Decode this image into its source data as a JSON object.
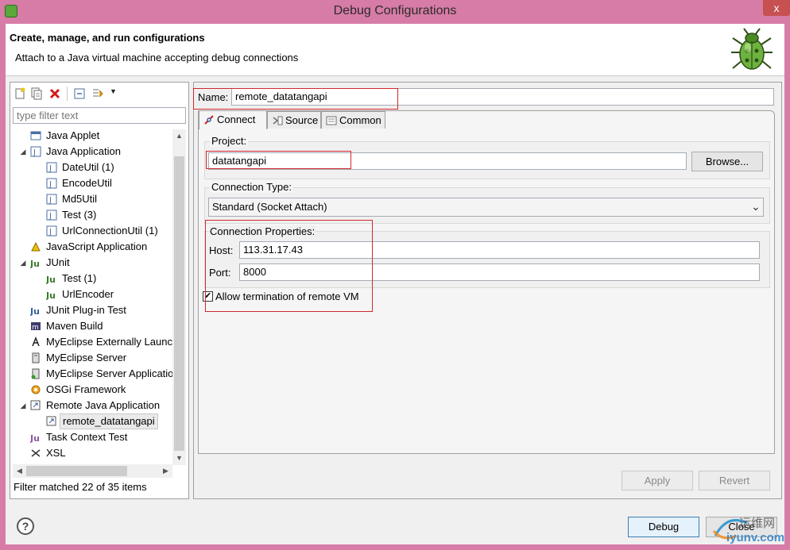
{
  "window": {
    "title": "Debug Configurations",
    "close_glyph": "x"
  },
  "header": {
    "title": "Create, manage, and run configurations",
    "subtitle": "Attach to a Java virtual machine accepting debug connections"
  },
  "toolbar": {
    "icons": [
      "new-configuration-icon",
      "duplicate-icon",
      "delete-icon",
      "collapse-all-icon",
      "filter-icon",
      "dropdown-arrow-icon"
    ],
    "dropdown_glyph": "▼"
  },
  "filter": {
    "placeholder": "type filter text",
    "status": "Filter matched 22 of 35 items"
  },
  "tree": {
    "items": [
      {
        "label": "Java Applet",
        "level": 1,
        "icon": "applet-icon",
        "expander": ""
      },
      {
        "label": "Java Application",
        "level": 1,
        "icon": "java-app-icon",
        "expander": "◢"
      },
      {
        "label": "DateUtil (1)",
        "level": 2,
        "icon": "java-class-icon",
        "expander": ""
      },
      {
        "label": "EncodeUtil",
        "level": 2,
        "icon": "java-class-icon",
        "expander": ""
      },
      {
        "label": "Md5Util",
        "level": 2,
        "icon": "java-class-icon",
        "expander": ""
      },
      {
        "label": "Test (3)",
        "level": 2,
        "icon": "java-class-icon",
        "expander": ""
      },
      {
        "label": "UrlConnectionUtil (1)",
        "level": 2,
        "icon": "java-class-icon",
        "expander": ""
      },
      {
        "label": "JavaScript Application",
        "level": 1,
        "icon": "javascript-icon",
        "expander": ""
      },
      {
        "label": "JUnit",
        "level": 1,
        "icon": "junit-icon",
        "expander": "◢"
      },
      {
        "label": "Test (1)",
        "level": 2,
        "icon": "junit-icon",
        "expander": ""
      },
      {
        "label": "UrlEncoder",
        "level": 2,
        "icon": "junit-icon",
        "expander": ""
      },
      {
        "label": "JUnit Plug-in Test",
        "level": 1,
        "icon": "junit-plugin-icon",
        "expander": ""
      },
      {
        "label": "Maven Build",
        "level": 1,
        "icon": "maven-icon",
        "expander": ""
      },
      {
        "label": "MyEclipse Externally Launch",
        "level": 1,
        "icon": "external-launch-icon",
        "expander": ""
      },
      {
        "label": "MyEclipse Server",
        "level": 1,
        "icon": "server-icon",
        "expander": ""
      },
      {
        "label": "MyEclipse Server Applicatio",
        "level": 1,
        "icon": "server-app-icon",
        "expander": ""
      },
      {
        "label": "OSGi Framework",
        "level": 1,
        "icon": "osgi-icon",
        "expander": ""
      },
      {
        "label": "Remote Java Application",
        "level": 1,
        "icon": "remote-java-icon",
        "expander": "◢"
      },
      {
        "label": "remote_datatangapi",
        "level": 2,
        "icon": "remote-config-icon",
        "expander": "",
        "selected": true
      },
      {
        "label": "Task Context Test",
        "level": 1,
        "icon": "task-context-icon",
        "expander": ""
      },
      {
        "label": "XSL",
        "level": 1,
        "icon": "xsl-icon",
        "expander": ""
      }
    ],
    "scroll_glyphs": {
      "up": "▲",
      "down": "▼",
      "left": "◀",
      "right": "▶"
    }
  },
  "config": {
    "name_label": "Name:",
    "name_value": "remote_datatangapi",
    "tabs": [
      {
        "label": "Connect",
        "icon": "connect-icon",
        "active": true
      },
      {
        "label": "Source",
        "icon": "source-icon",
        "active": false
      },
      {
        "label": "Common",
        "icon": "common-icon",
        "active": false
      }
    ],
    "project_label": "Project:",
    "project_value": "datatangapi",
    "browse_label": "Browse...",
    "connection_type_label": "Connection Type:",
    "connection_type_value": "Standard (Socket Attach)",
    "connection_props_label": "Connection Properties:",
    "host_label": "Host:",
    "host_value": "113.31.17.43",
    "port_label": "Port:",
    "port_value": "8000",
    "allow_termination_label": "Allow termination of remote VM",
    "allow_termination_checked": true,
    "check_glyph": "✔",
    "select_glyph": "⌄",
    "apply_label": "Apply",
    "revert_label": "Revert"
  },
  "footer": {
    "help_glyph": "?",
    "debug_label": "Debug",
    "close_label": "Close"
  },
  "watermark": {
    "text_top": "运维网",
    "text_bottom": "iyunv.com"
  },
  "colors": {
    "titlebar": "#d77ca6",
    "highlight_box": "#d3282c",
    "selection": "#cce8ff",
    "accent_blue": "#3c7fb1"
  }
}
